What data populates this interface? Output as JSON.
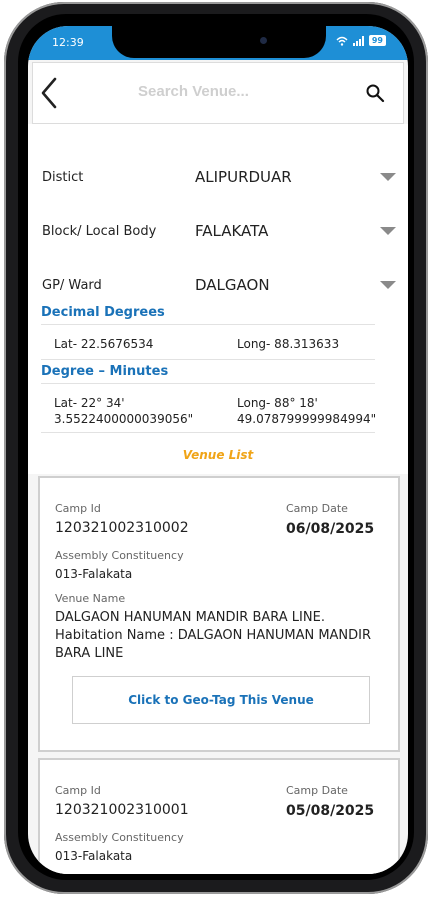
{
  "status_bar": {
    "time": "12:39",
    "battery": "99"
  },
  "search": {
    "placeholder": "Search Venue..."
  },
  "form": {
    "district": {
      "label": "Distict",
      "value": "ALIPURDUAR"
    },
    "block": {
      "label": "Block/ Local Body",
      "value": "FALAKATA"
    },
    "gp": {
      "label": "GP/ Ward",
      "value": "DALGAON"
    }
  },
  "decimal": {
    "title": "Decimal Degrees",
    "lat": "Lat- 22.5676534",
    "long": "Long- 88.313633"
  },
  "dms": {
    "title": "Degree – Minutes",
    "lat_line1": "Lat- 22° 34'",
    "lat_line2": "3.5522400000039056\"",
    "long_line1": "Long- 88° 18'",
    "long_line2": "49.078799999984994\""
  },
  "venue_list_title": "Venue List",
  "venues": [
    {
      "camp_id_label": "Camp Id",
      "camp_id": "120321002310002",
      "camp_date_label": "Camp Date",
      "camp_date": "06/08/2025",
      "ac_label": "Assembly Constituency",
      "ac": "013-Falakata",
      "venue_name_label": "Venue Name",
      "venue_name": "DALGAON HANUMAN MANDIR BARA LINE. Habitation Name : DALGAON HANUMAN MANDIR BARA LINE",
      "geo_tag_label": "Click to Geo-Tag This Venue"
    },
    {
      "camp_id_label": "Camp Id",
      "camp_id": "120321002310001",
      "camp_date_label": "Camp Date",
      "camp_date": "05/08/2025",
      "ac_label": "Assembly Constituency",
      "ac": "013-Falakata"
    }
  ]
}
